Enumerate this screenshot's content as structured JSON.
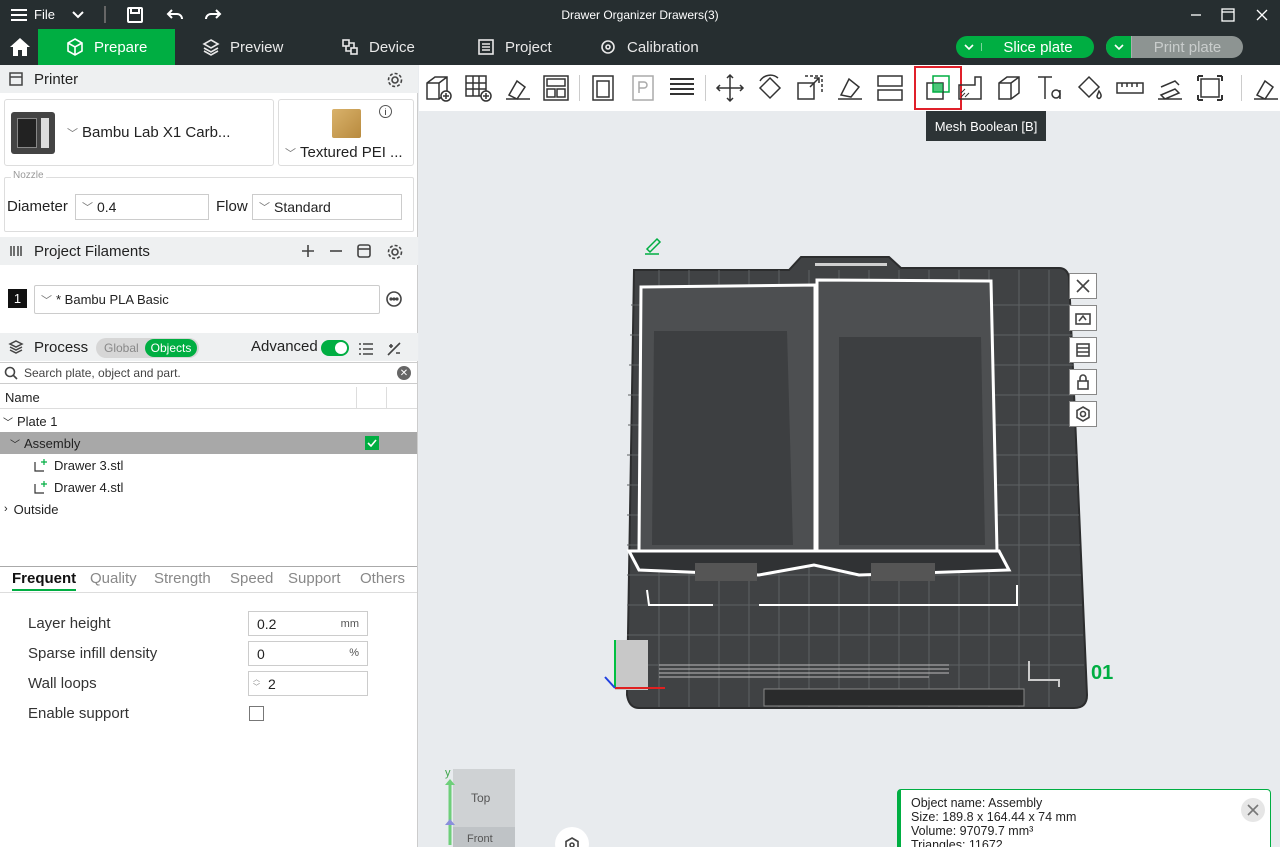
{
  "window": {
    "title": "Drawer Organizer Drawers(3)",
    "file_menu": "File"
  },
  "nav": {
    "tabs": [
      {
        "label": "Prepare"
      },
      {
        "label": "Preview"
      },
      {
        "label": "Device"
      },
      {
        "label": "Project"
      },
      {
        "label": "Calibration"
      }
    ],
    "slice_button": "Slice plate",
    "print_button": "Print plate"
  },
  "printer": {
    "section_title": "Printer",
    "printer_name": "Bambu Lab X1 Carb...",
    "plate_name": "Textured PEI ...",
    "nozzle_group_label": "Nozzle",
    "diameter_label": "Diameter",
    "diameter_value": "0.4",
    "flow_label": "Flow",
    "flow_value": "Standard"
  },
  "filaments": {
    "section_title": "Project Filaments",
    "items": [
      {
        "index": "1",
        "name": "* Bambu PLA Basic",
        "color": "#111111"
      }
    ]
  },
  "process": {
    "section_title": "Process",
    "toggle_global": "Global",
    "toggle_objects": "Objects",
    "advanced_label": "Advanced",
    "search_placeholder": "Search plate, object and part.",
    "tree_header": "Name",
    "tree": {
      "plate": "Plate 1",
      "assembly": "Assembly",
      "parts": [
        "Drawer 3.stl",
        "Drawer 4.stl"
      ],
      "outside": "Outside"
    },
    "subtabs": [
      "Frequent",
      "Quality",
      "Strength",
      "Speed",
      "Support",
      "Others"
    ],
    "params": {
      "layer_height_label": "Layer height",
      "layer_height_value": "0.2",
      "layer_height_unit": "mm",
      "infill_label": "Sparse infill density",
      "infill_value": "0",
      "infill_unit": "%",
      "wall_loops_label": "Wall loops",
      "wall_loops_value": "2",
      "support_label": "Enable support"
    }
  },
  "toolbar": {
    "tooltip": "Mesh Boolean [B]",
    "tools": [
      "add-icon",
      "add-plate-icon",
      "auto-orient-icon",
      "arrange-icon",
      "split-objects-icon",
      "split-parts-icon",
      "variable-layer-icon",
      "move-icon",
      "rotate-icon",
      "scale-icon",
      "lay-on-face-icon",
      "cut-icon",
      "mesh-boolean-icon",
      "support-paint-icon",
      "seam-paint-icon",
      "text-icon",
      "color-paint-icon",
      "measure-icon",
      "assembly-view-icon",
      "fit-icon"
    ]
  },
  "canvas": {
    "plate_number": "01",
    "view_top": "Top",
    "view_front": "Front",
    "axis_y": "y"
  },
  "object_info": {
    "name_line": "Object name: Assembly",
    "size_line": "Size: 189.8 x 164.44 x 74 mm",
    "volume_line": "Volume: 97079.7 mm³",
    "triangles_line": "Triangles: 11672"
  },
  "colors": {
    "accent": "#00ae42",
    "dark": "#262e30"
  }
}
